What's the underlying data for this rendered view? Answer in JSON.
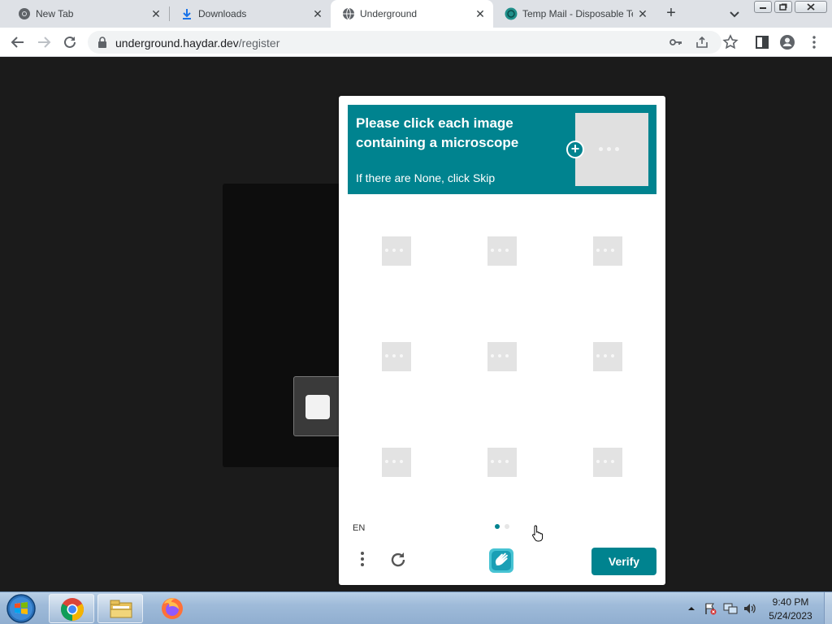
{
  "browser": {
    "tabs": [
      {
        "title": "New Tab",
        "icon": "chrome-icon",
        "active": false
      },
      {
        "title": "Downloads",
        "icon": "download-icon",
        "active": false
      },
      {
        "title": "Underground",
        "icon": "globe-icon",
        "active": true
      },
      {
        "title": "Temp Mail - Disposable Te",
        "icon": "tempmail-icon",
        "active": false
      }
    ],
    "new_tab_label": "+",
    "close_label": "✕",
    "url": {
      "host": "underground.haydar.dev",
      "path": "/register"
    }
  },
  "captcha": {
    "prompt": "Please click each image containing a microscope",
    "sub_prompt": "If there are None, click Skip",
    "language": "EN",
    "verify_label": "Verify",
    "accent": "#00838f",
    "tiles": 9,
    "page_count": 2,
    "current_page": 1
  },
  "taskbar": {
    "time": "9:40 PM",
    "date": "5/24/2023",
    "apps": [
      "chrome-icon",
      "file-explorer-icon",
      "firefox-icon"
    ]
  }
}
